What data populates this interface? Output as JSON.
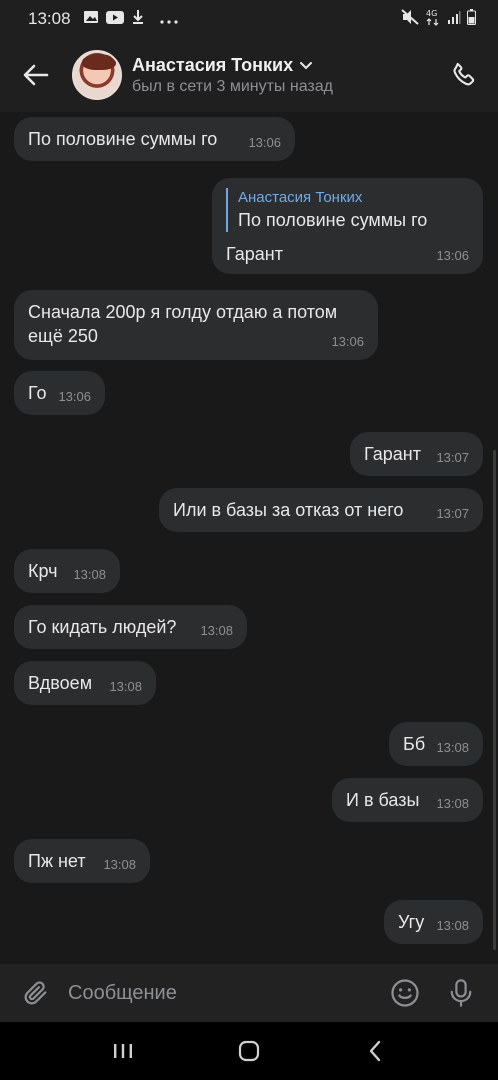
{
  "status_bar": {
    "time": "13:08",
    "left_icons": [
      "image-icon",
      "youtube-icon",
      "download-icon",
      "more-dots-icon"
    ],
    "right_icons": [
      "mute-icon",
      "4g-icon",
      "signal-icon",
      "battery-icon"
    ],
    "network": "4G"
  },
  "header": {
    "contact_name": "Анастасия Тонких",
    "contact_status": "был в сети 3 минуты назад"
  },
  "messages": [
    {
      "side": "in",
      "text": "По половине суммы го",
      "time": "13:06"
    },
    {
      "side": "out",
      "reply_author": "Анастасия Тонких",
      "reply_text": "По половине суммы го",
      "text": "Гарант",
      "time": "13:06"
    },
    {
      "side": "in",
      "text": "Сначала 200р я голду отдаю а потом",
      "text2": "ещё 250",
      "time": "13:06"
    },
    {
      "side": "in",
      "text": "Го",
      "time": "13:06"
    },
    {
      "side": "out",
      "text": "Гарант",
      "time": "13:07"
    },
    {
      "side": "out",
      "text": "Или в базы за отказ от него",
      "time": "13:07"
    },
    {
      "side": "in",
      "text": "Крч",
      "time": "13:08"
    },
    {
      "side": "in",
      "text": "Го кидать людей?",
      "time": "13:08"
    },
    {
      "side": "in",
      "text": "Вдвоем",
      "time": "13:08"
    },
    {
      "side": "out",
      "text": "Бб",
      "time": "13:08"
    },
    {
      "side": "out",
      "text": "И в базы",
      "time": "13:08"
    },
    {
      "side": "in",
      "text": "Пж нет",
      "time": "13:08"
    },
    {
      "side": "out",
      "text": "Угу",
      "time": "13:08"
    }
  ],
  "composer": {
    "placeholder": "Сообщение"
  },
  "colors": {
    "background": "#191919",
    "bubble": "#2c2d2e",
    "accent": "#71aaeb",
    "muted": "#8d8f93"
  }
}
